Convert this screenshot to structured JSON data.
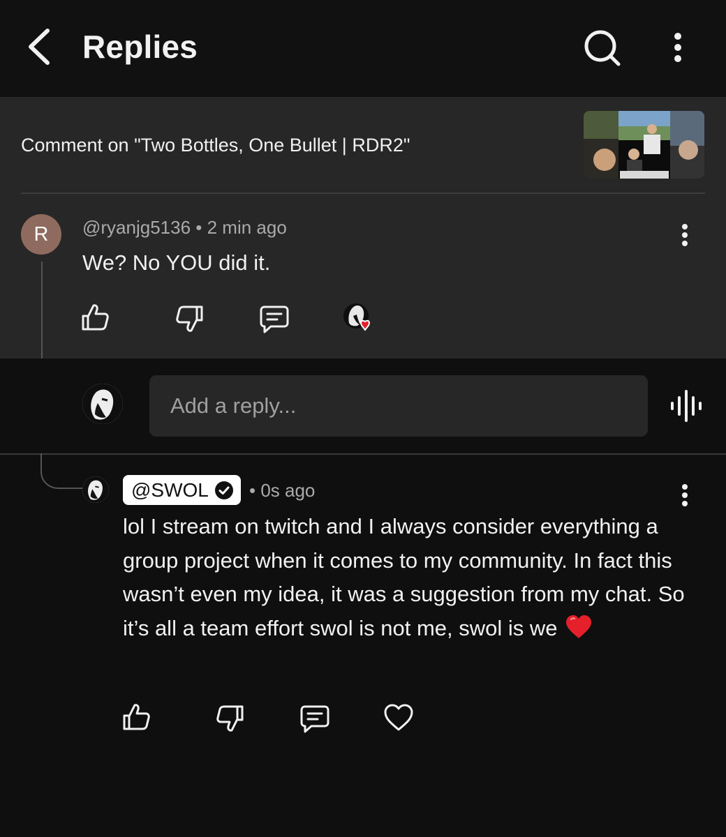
{
  "header": {
    "title": "Replies"
  },
  "context": {
    "prefix": "Comment on ",
    "video_title": "\"Two Bottles, One Bullet | RDR2\""
  },
  "parent_comment": {
    "avatar_letter": "R",
    "author": "@ryanjg5136",
    "separator": " • ",
    "time": "2 min ago",
    "text": "We? No YOU did it.",
    "avatar_color": "#8f6a5e"
  },
  "reply_box": {
    "placeholder": "Add a reply..."
  },
  "reply": {
    "author": "@SWOL",
    "time": "• 0s ago",
    "text": "lol I stream on twitch and I always consider everything a group project when it comes to my community. In fact this wasn’t even my idea, it was a suggestion from my chat. So it’s all a team effort swol is not me, swol is we"
  },
  "icons": {
    "back": "chevron-left-icon",
    "search": "search-icon",
    "more": "more-vertical-icon",
    "like": "thumbs-up-icon",
    "dislike": "thumbs-down-icon",
    "reply": "comment-icon",
    "heart": "heart-icon",
    "voice": "voice-search-icon",
    "verified": "verified-check-icon"
  },
  "colors": {
    "background": "#0f0f0f",
    "card": "#272727",
    "heart": "#e5202a",
    "muted_text": "#aaaaaa"
  }
}
